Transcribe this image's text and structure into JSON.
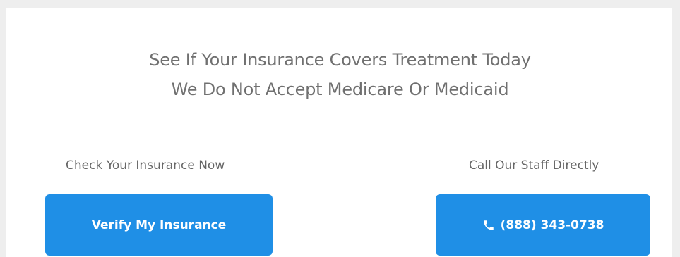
{
  "heading": {
    "line1": "See If Your Insurance Covers Treatment Today",
    "line2": "We Do Not Accept Medicare Or Medicaid"
  },
  "left_column": {
    "label": "Check Your Insurance Now",
    "button_label": "Verify My Insurance"
  },
  "right_column": {
    "label": "Call Our Staff Directly",
    "button_label": "(888) 343-0738",
    "button_icon": "phone-icon"
  },
  "colors": {
    "button_bg": "#1f8fe6",
    "heading_text": "#707070",
    "page_bg": "#eeeeee"
  }
}
